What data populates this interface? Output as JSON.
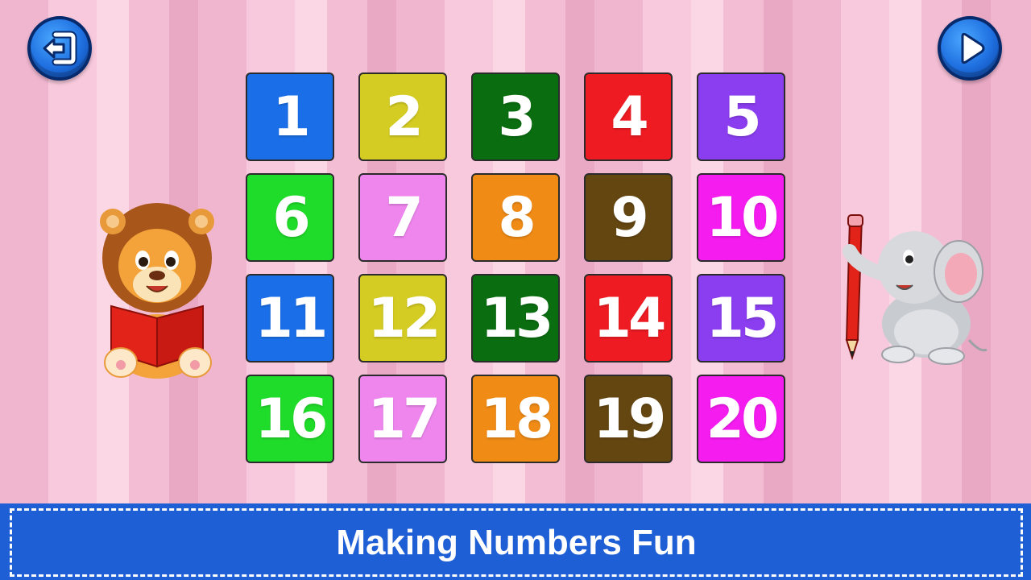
{
  "buttons": {
    "exit": "exit-icon",
    "play": "play-icon"
  },
  "tiles": [
    {
      "label": "1",
      "color": "#1a6fe8"
    },
    {
      "label": "2",
      "color": "#d4cc22"
    },
    {
      "label": "3",
      "color": "#0a6e10"
    },
    {
      "label": "4",
      "color": "#ee1c22"
    },
    {
      "label": "5",
      "color": "#8b3ef0"
    },
    {
      "label": "6",
      "color": "#20dc2a"
    },
    {
      "label": "7",
      "color": "#ee86ee"
    },
    {
      "label": "8",
      "color": "#f08b16"
    },
    {
      "label": "9",
      "color": "#644611"
    },
    {
      "label": "10",
      "color": "#f51cf0"
    },
    {
      "label": "11",
      "color": "#1a6fe8"
    },
    {
      "label": "12",
      "color": "#d4cc22"
    },
    {
      "label": "13",
      "color": "#0a6e10"
    },
    {
      "label": "14",
      "color": "#ee1c22"
    },
    {
      "label": "15",
      "color": "#8b3ef0"
    },
    {
      "label": "16",
      "color": "#20dc2a"
    },
    {
      "label": "17",
      "color": "#ee86ee"
    },
    {
      "label": "18",
      "color": "#f08b16"
    },
    {
      "label": "19",
      "color": "#644611"
    },
    {
      "label": "20",
      "color": "#f51cf0"
    }
  ],
  "banner": {
    "text": "Making Numbers Fun",
    "color": "#1f5fd6"
  },
  "mascots": {
    "left": "lion-reading-book",
    "right": "elephant-with-pencil"
  }
}
